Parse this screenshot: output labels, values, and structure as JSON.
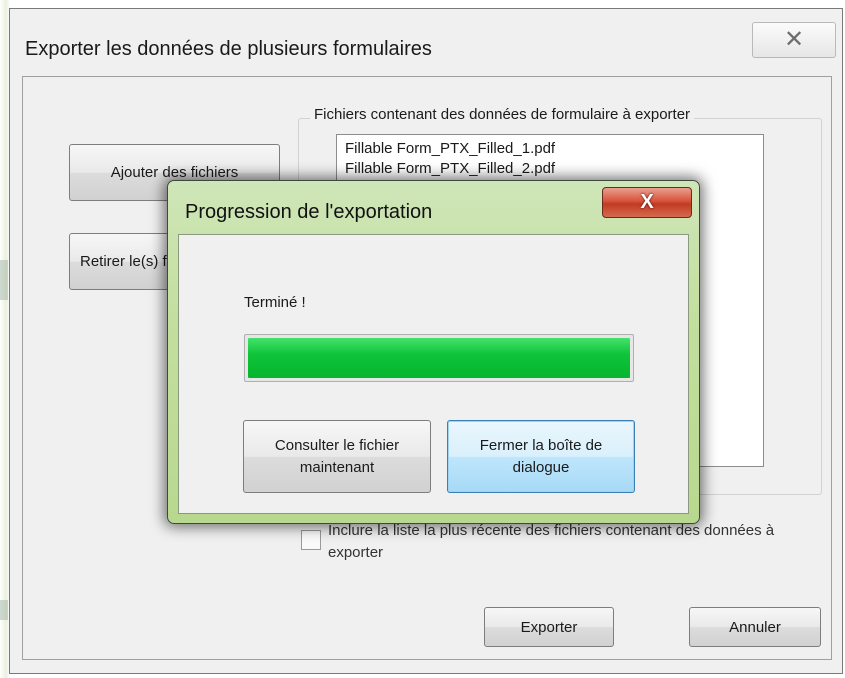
{
  "main_dialog": {
    "title": "Exporter les données de plusieurs formulaires",
    "close_glyph": "✕",
    "add_files_label": "Ajouter des fichiers",
    "remove_label": "Retirer le(s) fichier(s)",
    "group_label": "Fichiers contenant des données de formulaire à exporter",
    "files": [
      "Fillable Form_PTX_Filled_1.pdf",
      "Fillable Form_PTX_Filled_2.pdf"
    ],
    "include_recent_label": "Inclure la liste la plus récente des fichiers contenant des données à exporter",
    "export_label": "Exporter",
    "cancel_label": "Annuler"
  },
  "progress_dialog": {
    "title": "Progression de l'exportation",
    "close_glyph": "X",
    "status": "Terminé !",
    "progress_fraction": 1.0,
    "open_file_label": "Consulter le fichier maintenant",
    "close_dialog_label": "Fermer la boîte de dialogue"
  },
  "colors": {
    "progress_fill": "#0fc43a",
    "progress_frame": "#c3df9f",
    "close_red": "#d8533a",
    "focus_blue": "#3c7fb1"
  }
}
